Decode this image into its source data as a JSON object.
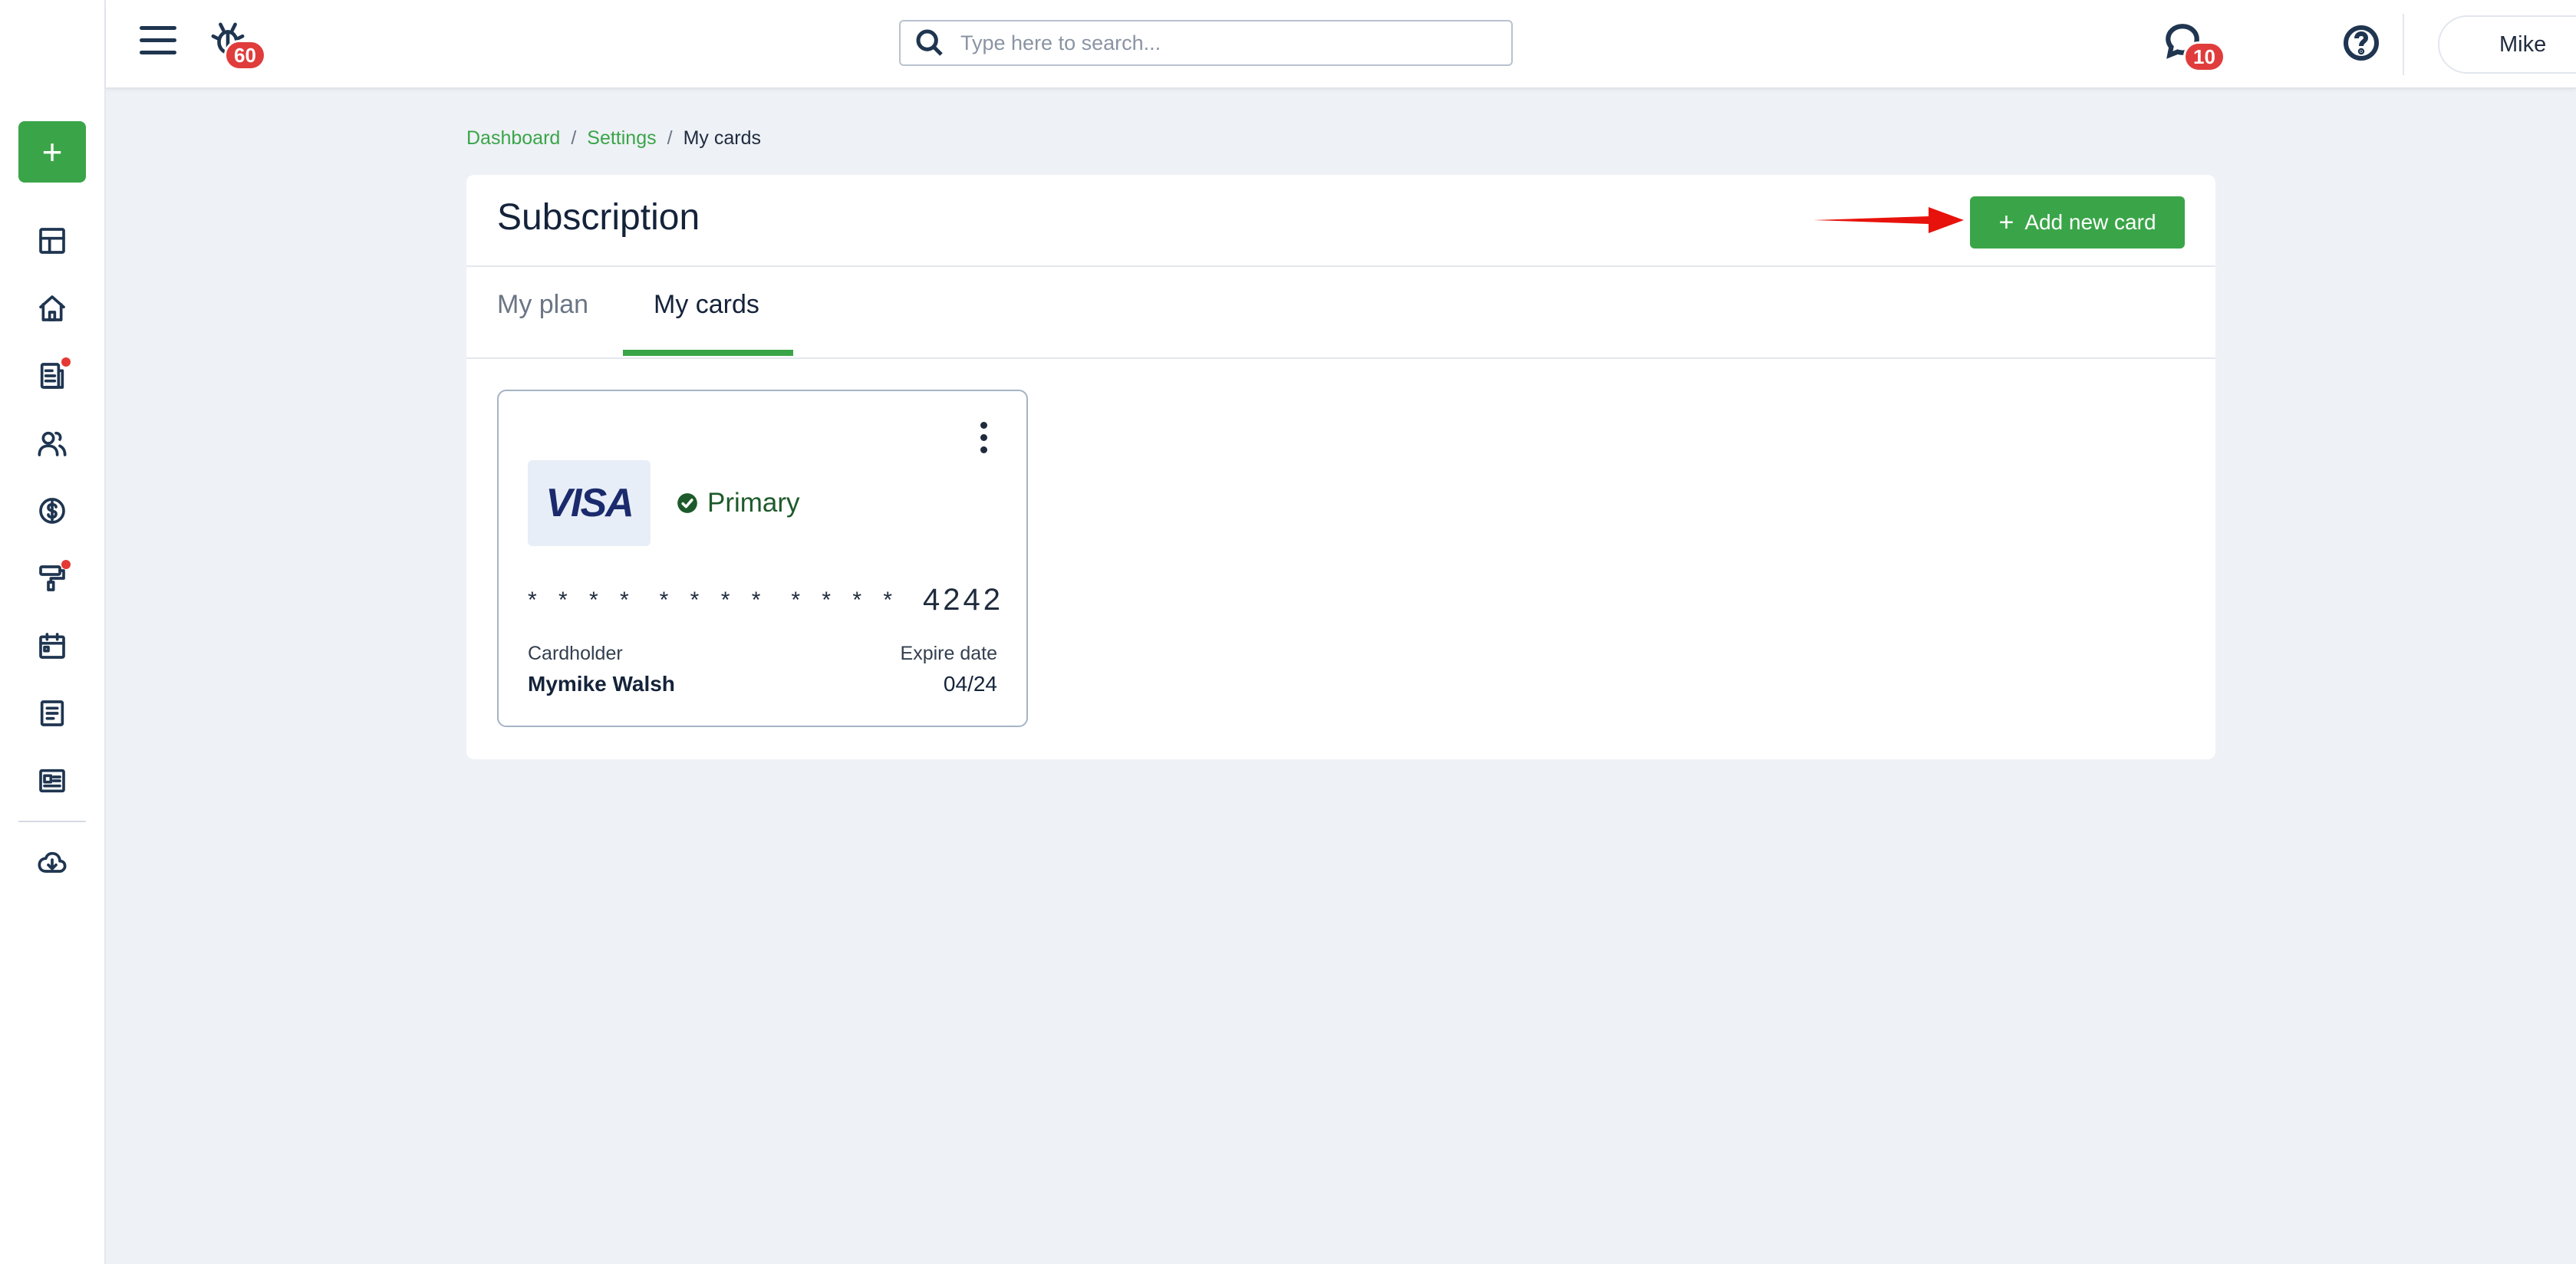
{
  "topbar": {
    "bug_badge": "60",
    "search_placeholder": "Type here to search...",
    "messages_badge": "10",
    "user_name": "Mike"
  },
  "breadcrumb": {
    "items": [
      "Dashboard",
      "Settings"
    ],
    "current": "My cards",
    "separator": "/"
  },
  "panel": {
    "title": "Subscription",
    "add_card_label": "Add new card",
    "tabs": [
      {
        "label": "My plan",
        "active": false
      },
      {
        "label": "My cards",
        "active": true
      }
    ]
  },
  "card": {
    "brand": "VISA",
    "status": "Primary",
    "masked_groups": [
      "****",
      "****",
      "****"
    ],
    "last4": "4242",
    "cardholder_label": "Cardholder",
    "cardholder_name": "Mymike Walsh",
    "expire_label": "Expire date",
    "expire_value": "04/24"
  },
  "colors": {
    "accent": "#3aa548",
    "badge": "#e03c3c",
    "arrow": "#e8120c",
    "background": "#eef1f6"
  }
}
